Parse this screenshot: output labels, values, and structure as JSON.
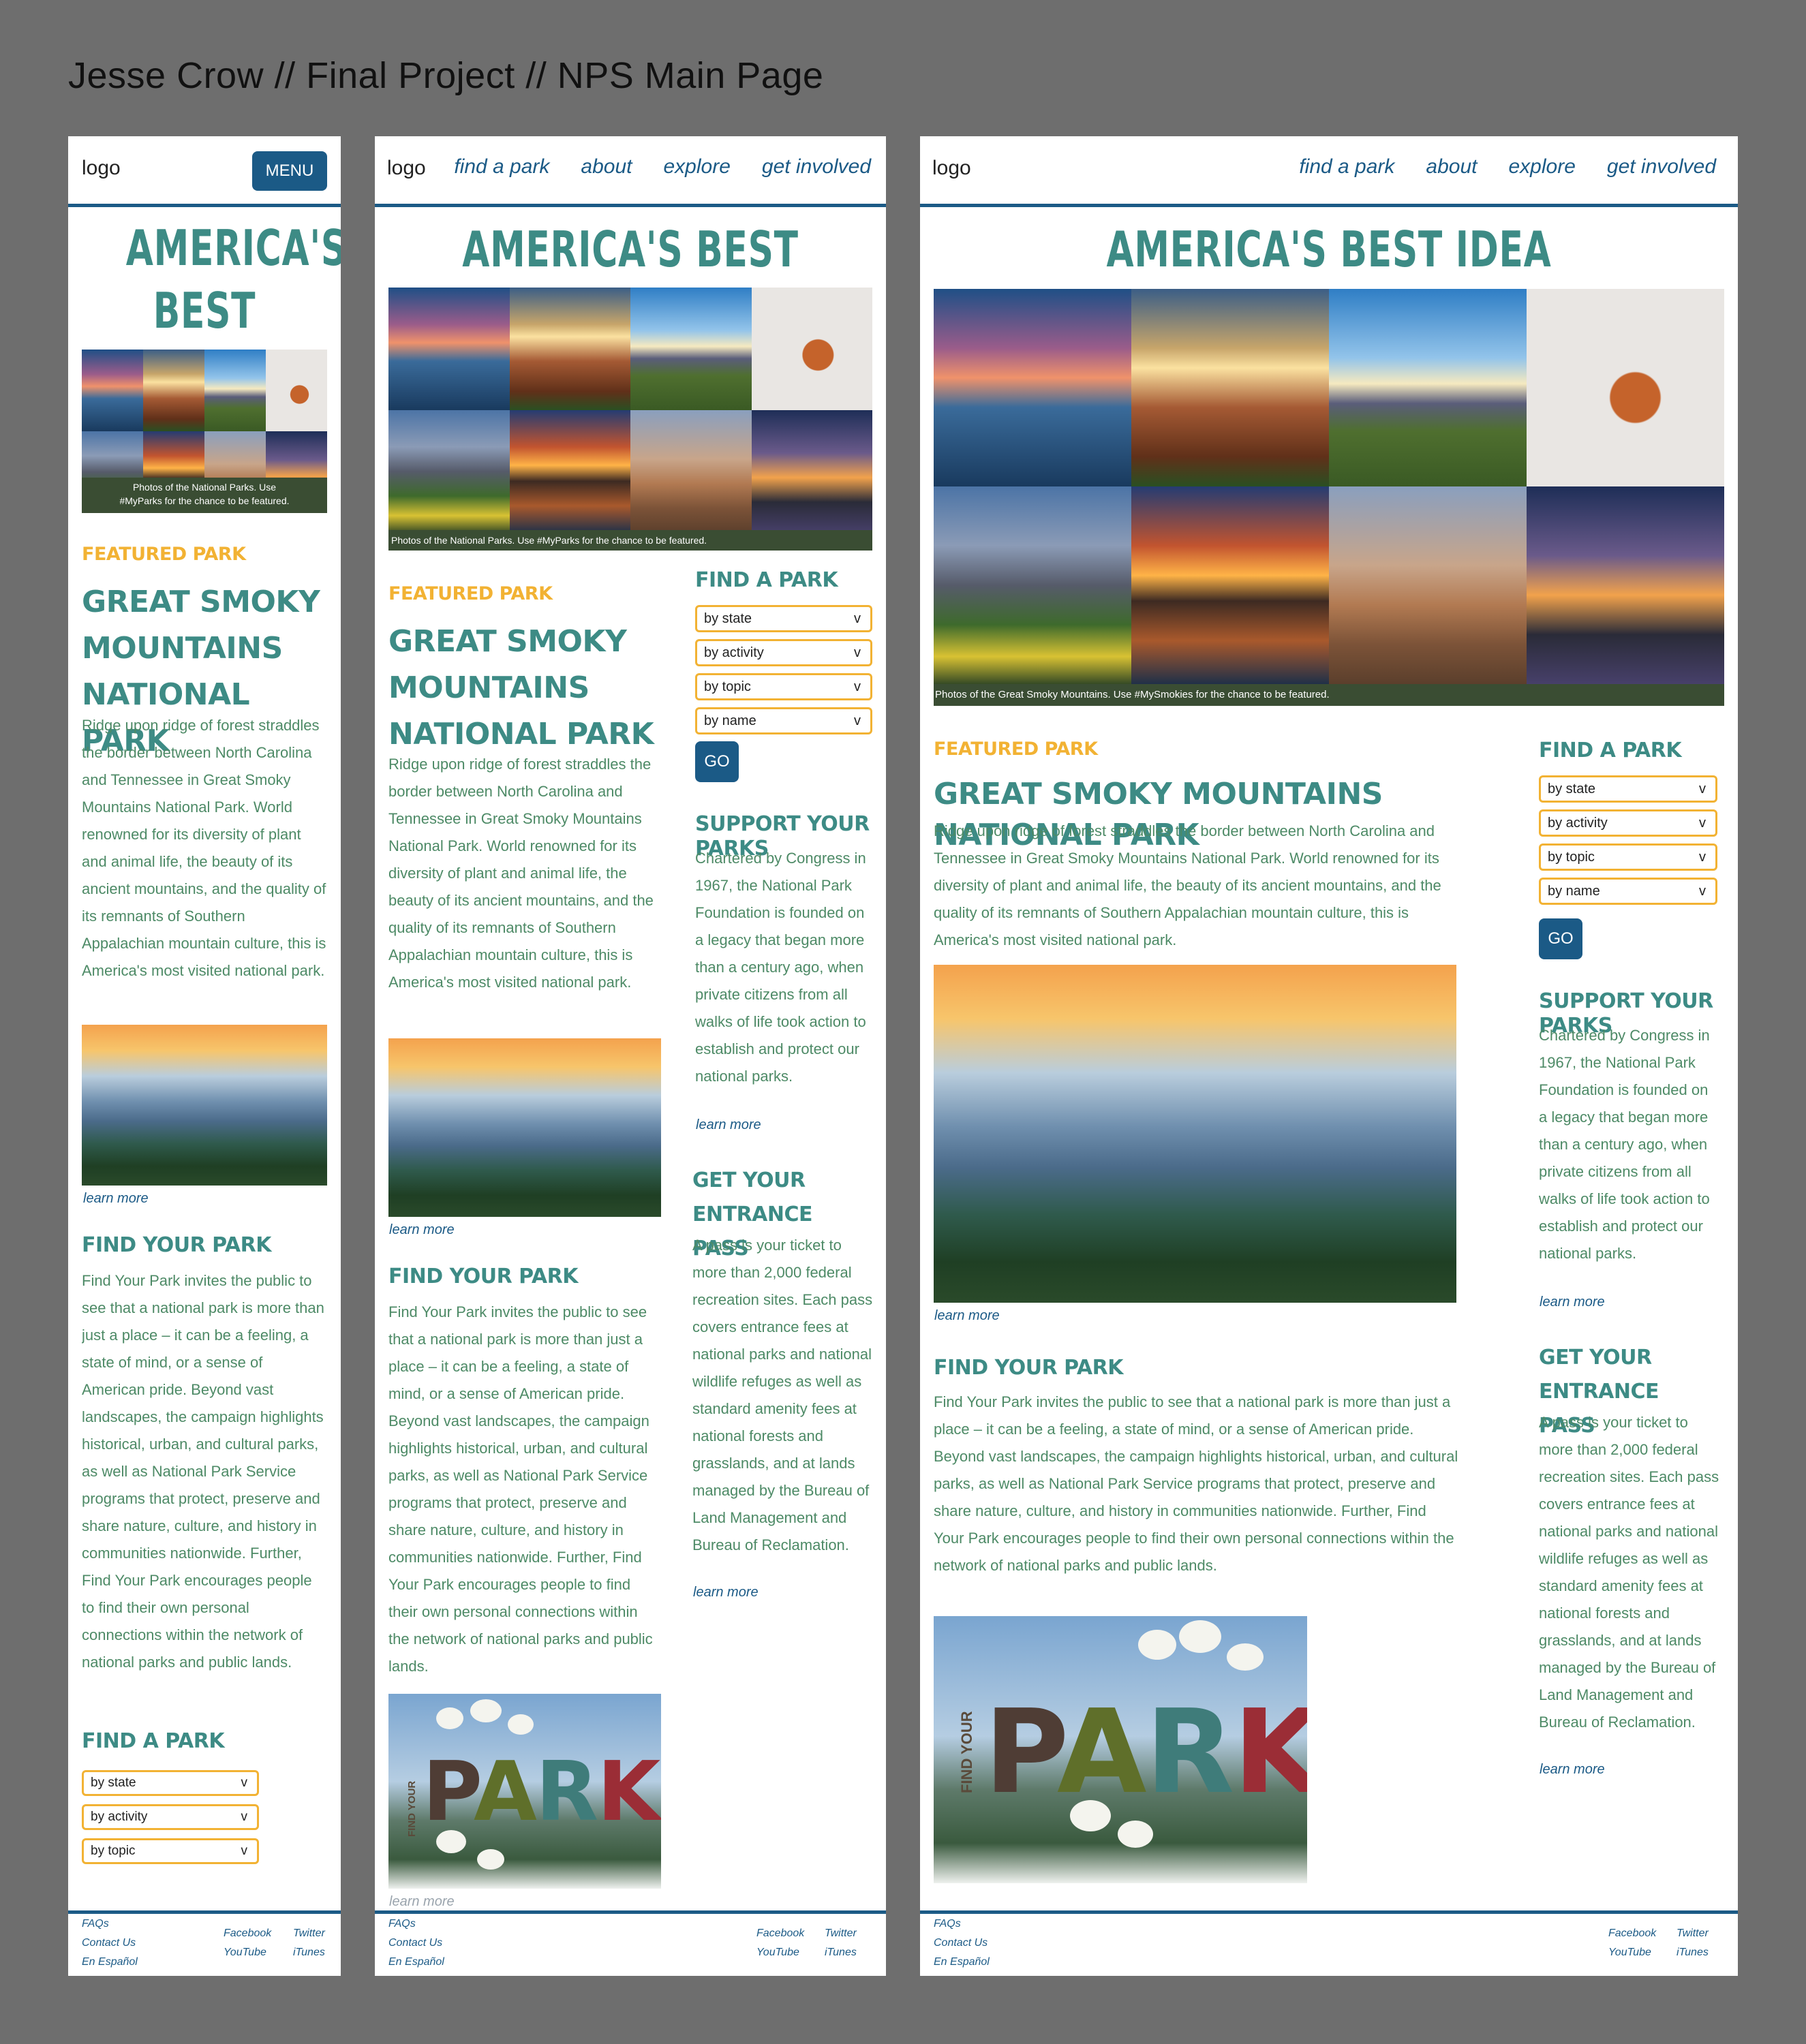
{
  "page_title": "Jesse Crow // Final Project // NPS Main Page",
  "header": {
    "logo": "logo",
    "menu_label": "MENU",
    "nav": [
      "find a park",
      "about",
      "explore",
      "get involved"
    ]
  },
  "hero": {
    "title": "AMERICA'S BEST IDEA",
    "caption_general": "Photos of the National Parks. Use #MyParks for the chance to be featured.",
    "caption_mobile": "Photos of the National Parks. Use #MyParks for the chance to be featured.",
    "caption_desktop": "Photos of the Great Smoky Mountains. Use #MySmokies for the chance to be featured."
  },
  "featured": {
    "label": "FEATURED PARK",
    "title": "GREAT SMOKY MOUNTAINS NATIONAL PARK",
    "body": "Ridge upon ridge of forest straddles the border between North Carolina and Tennessee in Great Smoky Mountains National Park. World renowned for its diversity of plant and animal life, the beauty of its ancient mountains, and the quality of its remnants of Southern Appalachian mountain culture, this is America's most visited national park.",
    "learn_more": "learn more"
  },
  "find_your_park": {
    "title": "FIND YOUR PARK",
    "body": "Find Your Park invites the public to see that a national park is more than just a place – it can be a feeling, a state of mind, or a sense of American pride. Beyond vast landscapes, the campaign highlights historical, urban, and cultural parks, as well as National Park Service programs that protect, preserve and share nature, culture, and history in communities nationwide. Further, Find Your Park encourages people to find their own personal connections within the network of national parks and public lands.",
    "learn_more": "learn more",
    "image_word_your": "FIND YOUR",
    "image_letters": [
      "P",
      "A",
      "R",
      "K"
    ]
  },
  "find_a_park": {
    "title": "FIND A PARK",
    "dropdowns": [
      "by state",
      "by activity",
      "by topic",
      "by name"
    ],
    "dropdown_arrow": "v",
    "go_label": "GO"
  },
  "support": {
    "title": "SUPPORT YOUR PARKS",
    "body": "Chartered by Congress in 1967, the National Park Foundation is founded on a legacy that began more than a century ago, when private citizens from all walks of life took action to establish and protect our national parks.",
    "learn_more": "learn more"
  },
  "entrance_pass": {
    "title": "GET YOUR ENTRANCE PASS",
    "body": "A pass is your ticket to more than 2,000 federal recreation sites. Each pass covers entrance fees at national parks and national wildlife refuges as well as standard amenity fees at national forests and grasslands, and at lands managed by the Bureau of Land Management and Bureau of Reclamation.",
    "learn_more": "learn more"
  },
  "footer": {
    "left": [
      "FAQs",
      "Contact Us",
      "En Español"
    ],
    "right": [
      "Facebook",
      "Twitter",
      "YouTube",
      "iTunes"
    ]
  },
  "colors": {
    "teal": "#3d8b85",
    "gold": "#f2b233",
    "navy": "#1b5a86",
    "green_text": "#4d8a66"
  }
}
